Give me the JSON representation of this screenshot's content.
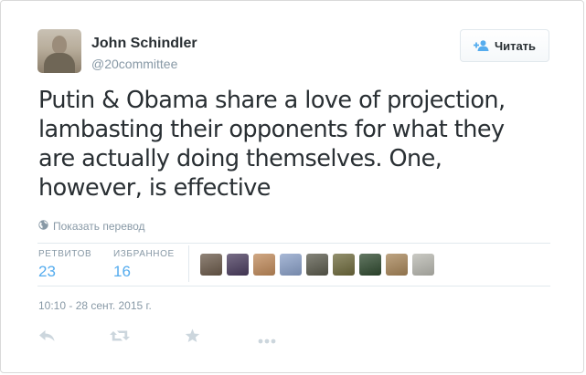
{
  "author": {
    "name": "John Schindler",
    "handle": "@20committee"
  },
  "follow_button": {
    "label": "Читать",
    "icon": "add-user-icon"
  },
  "tweet": {
    "text_lines": [
      "Putin & Obama share a love of projection,",
      "lambasting their opponents for what they",
      "are actually doing themselves. One,",
      "however, is effective"
    ]
  },
  "translate_link": {
    "label": "Показать перевод",
    "icon": "globe-icon"
  },
  "stats": {
    "retweets": {
      "label": "РЕТВИТОВ",
      "value": "23"
    },
    "favorites": {
      "label": "ИЗБРАННОЕ",
      "value": "16"
    }
  },
  "favorited_by": [
    {
      "name": "favoriter-avatar",
      "color": "#6b5a4a"
    },
    {
      "name": "favoriter-avatar",
      "color": "#4a3c5e"
    },
    {
      "name": "favoriter-avatar",
      "color": "#c08a5a"
    },
    {
      "name": "favoriter-avatar",
      "color": "#8aa0c8"
    },
    {
      "name": "favoriter-avatar",
      "color": "#5a5a4c"
    },
    {
      "name": "favoriter-avatar",
      "color": "#6e6a3c"
    },
    {
      "name": "favoriter-avatar",
      "color": "#2f4a2f"
    },
    {
      "name": "favoriter-avatar",
      "color": "#a78558"
    },
    {
      "name": "favoriter-avatar",
      "color": "#b8b8b0"
    }
  ],
  "timestamp": "10:10 - 28 сент. 2015 г.",
  "actions": [
    {
      "name": "reply-icon"
    },
    {
      "name": "retweet-icon"
    },
    {
      "name": "favorite-star-icon"
    },
    {
      "name": "more-options-icon"
    }
  ],
  "colors": {
    "accent": "#55acee",
    "muted": "#8899a6",
    "text": "#292f33",
    "border": "#e1e8ed",
    "action_icons": "#ccd6dd"
  }
}
